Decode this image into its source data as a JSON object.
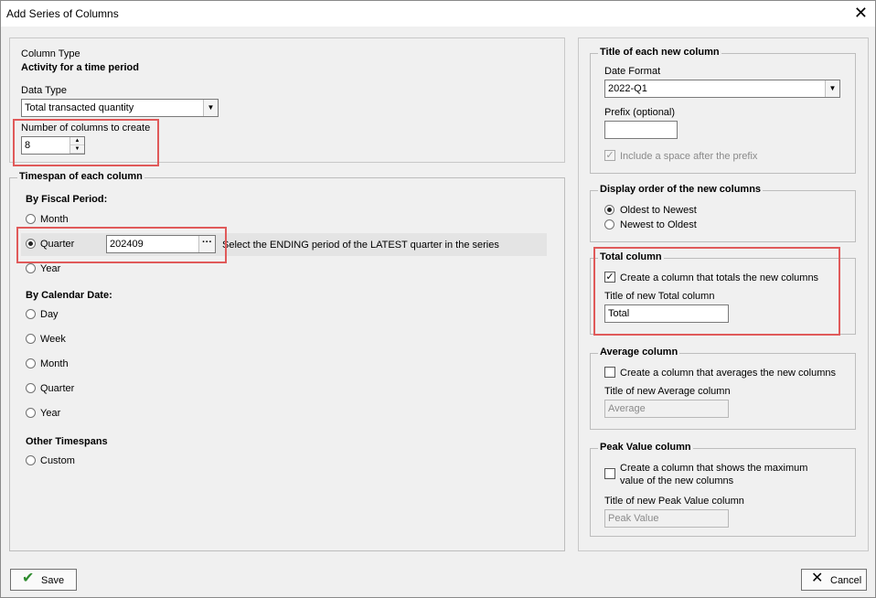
{
  "window": {
    "title": "Add Series of Columns",
    "close_glyph": "✕"
  },
  "column_type": {
    "label": "Column Type",
    "value": "Activity for a time period"
  },
  "data_type": {
    "label": "Data Type",
    "value": "Total transacted quantity"
  },
  "num_columns": {
    "label": "Number of columns to create",
    "value": "8"
  },
  "timespan": {
    "legend": "Timespan of each column",
    "fiscal_heading": "By Fiscal Period:",
    "fiscal_options": [
      "Month",
      "Quarter",
      "Year"
    ],
    "fiscal_selected": "Quarter",
    "quarter_value": "202409",
    "quarter_hint": "Select the ENDING period of the LATEST quarter in the series",
    "calendar_heading": "By Calendar Date:",
    "calendar_options": [
      "Day",
      "Week",
      "Month",
      "Quarter",
      "Year"
    ],
    "other_heading": "Other Timespans",
    "other_options": [
      "Custom"
    ]
  },
  "title_group": {
    "legend": "Title of each new column",
    "date_format_label": "Date Format",
    "date_format_value": "2022-Q1",
    "prefix_label": "Prefix (optional)",
    "prefix_value": "",
    "space_label": "Include a space after the prefix"
  },
  "display_order": {
    "legend": "Display order of the new columns",
    "options": [
      "Oldest to Newest",
      "Newest to Oldest"
    ],
    "selected": "Oldest to Newest"
  },
  "total_column": {
    "legend": "Total column",
    "check_label": "Create a column that totals the new columns",
    "checked": true,
    "title_label": "Title of new Total column",
    "title_value": "Total"
  },
  "average_column": {
    "legend": "Average column",
    "check_label": "Create a column that averages the new columns",
    "checked": false,
    "title_label": "Title of new Average column",
    "title_value": "Average"
  },
  "peak_column": {
    "legend": "Peak Value column",
    "check_label_line1": "Create a column that shows the maximum",
    "check_label_line2": "value of the new columns",
    "checked": false,
    "title_label": "Title of new Peak Value column",
    "title_value": "Peak Value"
  },
  "buttons": {
    "save": "Save",
    "cancel": "Cancel"
  },
  "colors": {
    "highlight": "#e05a5a",
    "save_check": "#2e8b2e"
  }
}
